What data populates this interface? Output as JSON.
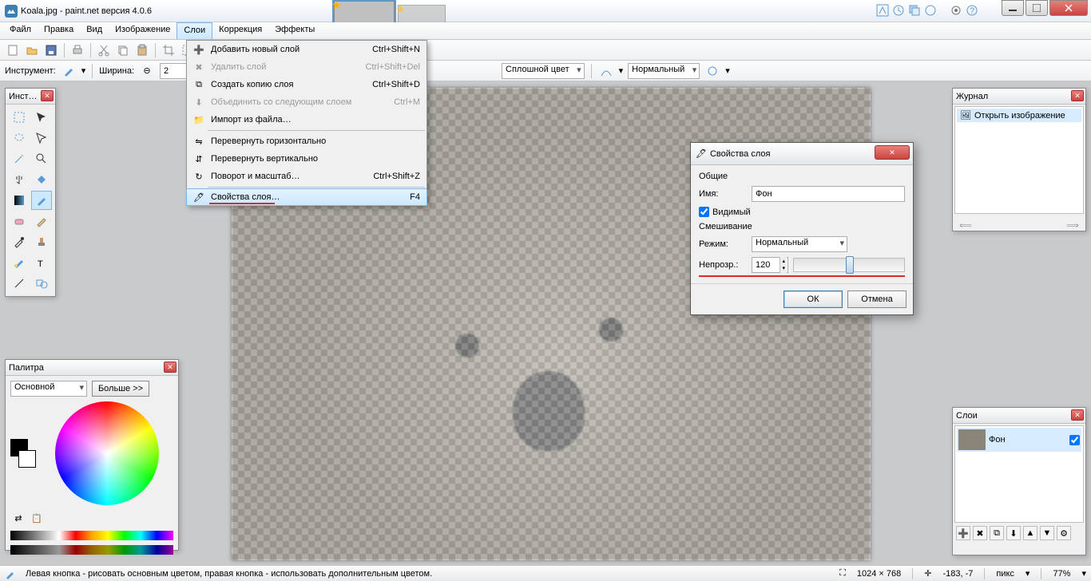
{
  "title": "Koala.jpg - paint.net версия 4.0.6",
  "menu": [
    "Файл",
    "Правка",
    "Вид",
    "Изображение",
    "Слои",
    "Коррекция",
    "Эффекты"
  ],
  "menu_open_index": 4,
  "layers_menu": [
    {
      "icon": "add-layer",
      "label": "Добавить новый слой",
      "sc": "Ctrl+Shift+N"
    },
    {
      "icon": "del-layer",
      "label": "Удалить слой",
      "sc": "Ctrl+Shift+Del",
      "disabled": true
    },
    {
      "icon": "dup-layer",
      "label": "Создать копию слоя",
      "sc": "Ctrl+Shift+D"
    },
    {
      "icon": "merge-layer",
      "label": "Объединить со следующим слоем",
      "sc": "Ctrl+M",
      "disabled": true
    },
    {
      "icon": "import",
      "label": "Импорт из файла…",
      "sc": ""
    },
    {
      "sep": true
    },
    {
      "icon": "flip-h",
      "label": "Перевернуть горизонтально",
      "sc": ""
    },
    {
      "icon": "flip-v",
      "label": "Перевернуть вертикально",
      "sc": ""
    },
    {
      "icon": "rotate",
      "label": "Поворот и масштаб…",
      "sc": "Ctrl+Shift+Z"
    },
    {
      "sep": true
    },
    {
      "icon": "props",
      "label": "Свойства слоя…",
      "sc": "F4",
      "hover": true,
      "underline": true
    }
  ],
  "optionbar": {
    "tool_label": "Инструмент:",
    "width_label": "Ширина:",
    "width_value": "2",
    "fill_label": "Сплошной цвет",
    "blend_label": "Нормальный"
  },
  "tools_panel_title": "Инст…",
  "palette": {
    "title": "Палитра",
    "mode": "Основной",
    "more": "Больше >>"
  },
  "history": {
    "title": "Журнал",
    "item": "Открыть изображение"
  },
  "layers": {
    "title": "Слои",
    "item": "Фон"
  },
  "dialog": {
    "title": "Свойства слоя",
    "section1": "Общие",
    "name_label": "Имя:",
    "name_value": "Фон",
    "visible": "Видимый",
    "section2": "Смешивание",
    "mode_label": "Режим:",
    "mode_value": "Нормальный",
    "opacity_label": "Непрозр.:",
    "opacity_value": "120",
    "ok": "ОК",
    "cancel": "Отмена"
  },
  "status": {
    "hint": "Левая кнопка - рисовать основным цветом, правая кнопка - использовать дополнительным цветом.",
    "size": "1024 × 768",
    "cursor": "-183, -7",
    "unit": "пикс",
    "zoom": "77%"
  },
  "colors": {
    "accent": "#3c7fb1",
    "danger": "#c94540",
    "highlight": "#d92b2b"
  }
}
